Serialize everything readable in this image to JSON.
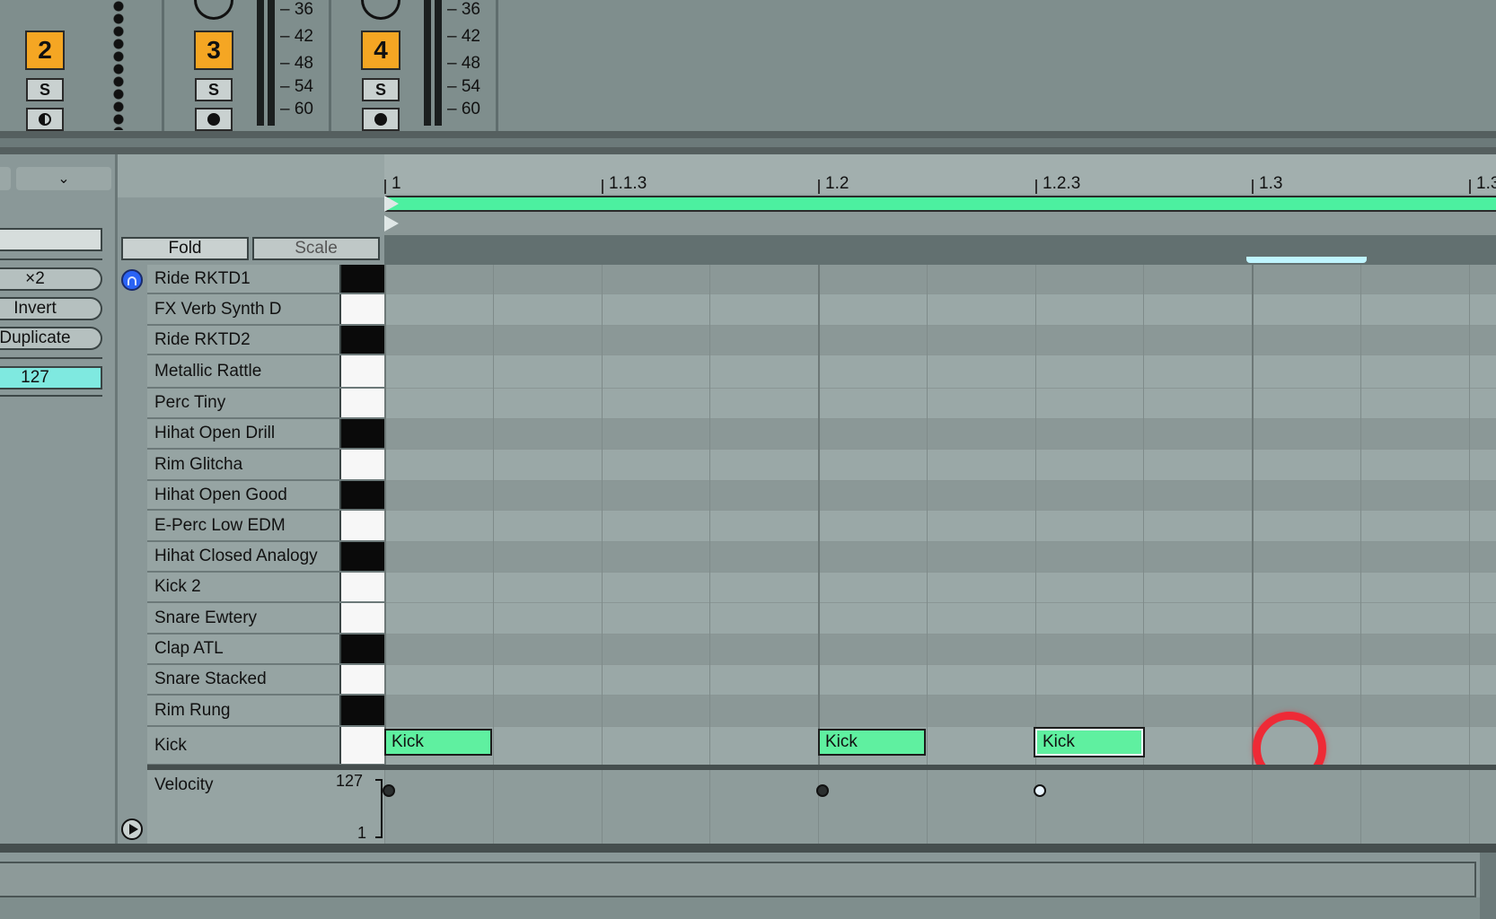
{
  "mixer": {
    "tracks": [
      {
        "number": "2",
        "solo_label": "S",
        "arm": "monitor"
      },
      {
        "number": "3",
        "solo_label": "S",
        "arm": "record"
      },
      {
        "number": "4",
        "solo_label": "S",
        "arm": "record"
      }
    ],
    "db_scale": [
      "36",
      "42",
      "48",
      "54",
      "60"
    ]
  },
  "left_panel": {
    "collapse_icon": "chevron-down-icon",
    "buttons": [
      {
        "label": "×2"
      },
      {
        "label": "Invert"
      },
      {
        "label": "Duplicate"
      }
    ],
    "velocity_value": "127"
  },
  "ruler": {
    "labels": [
      "1",
      "1.1.3",
      "1.2",
      "1.2.3",
      "1.3",
      "1.3"
    ]
  },
  "header": {
    "fold_label": "Fold",
    "scale_label": "Scale"
  },
  "keys": [
    {
      "name": "Ride RKTD1",
      "key": "black"
    },
    {
      "name": "FX Verb Synth D",
      "key": "white"
    },
    {
      "name": "Ride RKTD2",
      "key": "black"
    },
    {
      "name": "Metallic Rattle",
      "key": "white"
    },
    {
      "name": "Perc Tiny",
      "key": "white"
    },
    {
      "name": "Hihat Open Drill",
      "key": "black"
    },
    {
      "name": "Rim Glitcha",
      "key": "white"
    },
    {
      "name": "Hihat Open Good",
      "key": "black"
    },
    {
      "name": "E-Perc Low EDM",
      "key": "white"
    },
    {
      "name": "Hihat Closed Analogy",
      "key": "black"
    },
    {
      "name": "Kick 2",
      "key": "white"
    },
    {
      "name": "Snare Ewtery",
      "key": "white"
    },
    {
      "name": "Clap ATL",
      "key": "black"
    },
    {
      "name": "Snare Stacked",
      "key": "white"
    },
    {
      "name": "Rim Rung",
      "key": "black"
    },
    {
      "name": "Kick",
      "key": "white"
    }
  ],
  "notes": [
    {
      "label": "Kick",
      "beat": 1.0,
      "selected": false
    },
    {
      "label": "Kick",
      "beat": 1.2,
      "selected": false
    },
    {
      "label": "Kick",
      "beat": 1.3,
      "selected": true
    }
  ],
  "velocity": {
    "label": "Velocity",
    "max": "127",
    "min": "1"
  },
  "colors": {
    "note": "#5ff0a0",
    "track_number": "#f5a623",
    "velocity_field": "#7fe9e0",
    "cursor_ring": "#ee2a36",
    "preview_icon": "#2b63f5"
  }
}
